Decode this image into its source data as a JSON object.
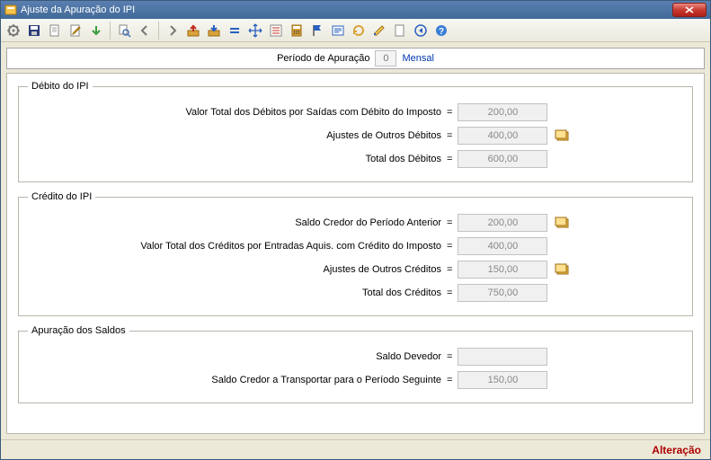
{
  "window": {
    "title": "Ajuste da Apuração do IPI"
  },
  "period": {
    "label": "Período de Apuração",
    "value": "0",
    "type": "Mensal"
  },
  "debito": {
    "legend": "Débito do IPI",
    "rows": {
      "total_saidas": {
        "label": "Valor Total dos Débitos por Saídas com Débito do Imposto",
        "value": "200,00"
      },
      "ajustes_outros": {
        "label": "Ajustes de Outros Débitos",
        "value": "400,00"
      },
      "total": {
        "label": "Total dos Débitos",
        "value": "600,00"
      }
    }
  },
  "credito": {
    "legend": "Crédito do IPI",
    "rows": {
      "saldo_anterior": {
        "label": "Saldo Credor do Período Anterior",
        "value": "200,00"
      },
      "total_entradas": {
        "label": "Valor Total dos Créditos por Entradas Aquis. com Crédito do Imposto",
        "value": "400,00"
      },
      "ajustes_outros": {
        "label": "Ajustes de Outros Créditos",
        "value": "150,00"
      },
      "total": {
        "label": "Total dos Créditos",
        "value": "750,00"
      }
    }
  },
  "apuracao": {
    "legend": "Apuração dos Saldos",
    "rows": {
      "saldo_devedor": {
        "label": "Saldo Devedor",
        "value": ""
      },
      "saldo_transportar": {
        "label": "Saldo Credor a Transportar para o Período Seguinte",
        "value": "150,00"
      }
    }
  },
  "status": {
    "text": "Alteração"
  },
  "eq": "="
}
